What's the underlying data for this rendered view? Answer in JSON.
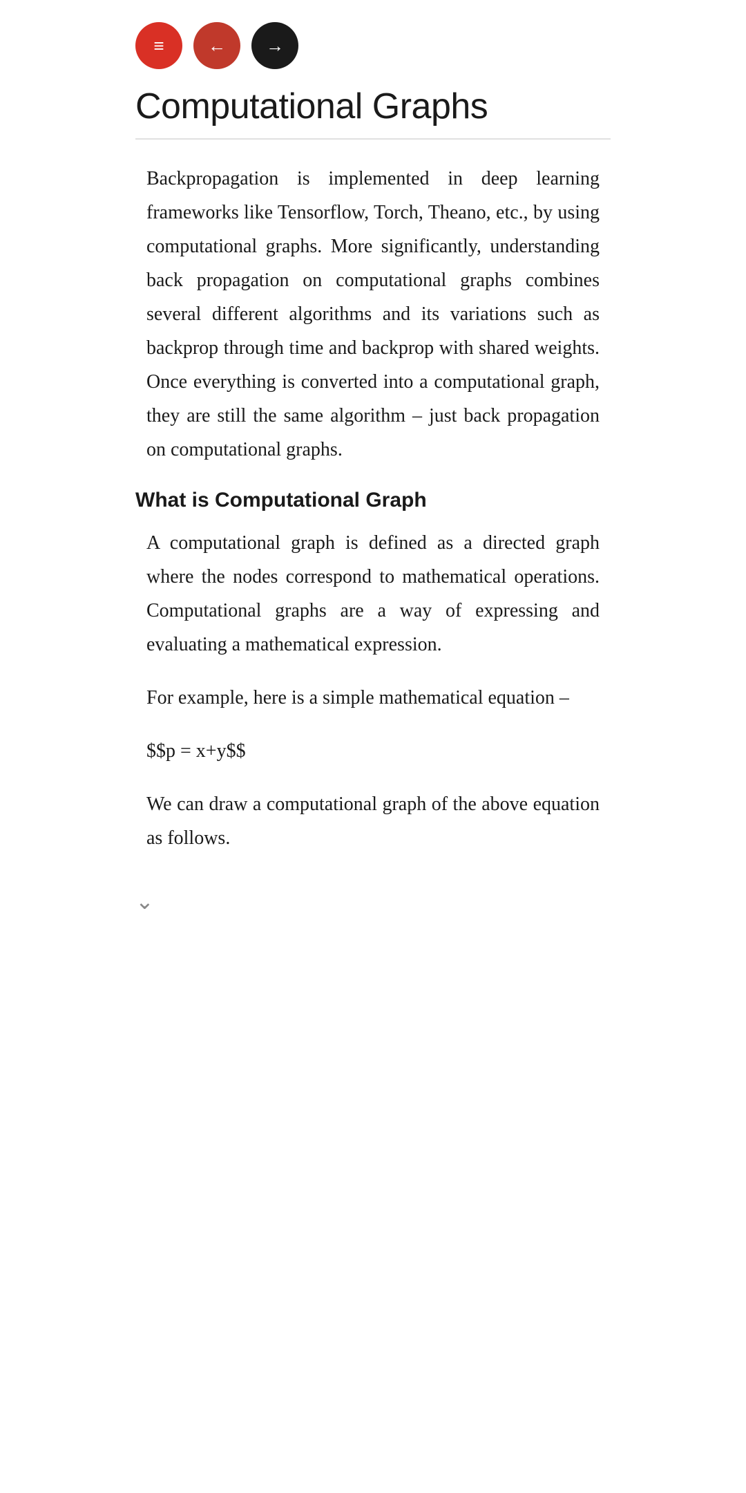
{
  "topBar": {
    "menuIcon": "≡",
    "backIcon": "←",
    "forwardIcon": "→"
  },
  "pageTitle": "Computational Graphs",
  "divider": true,
  "mainParagraph": "Backpropagation is implemented in deep learning frameworks like Tensorflow, Torch, Theano, etc., by using computational graphs. More significantly, understanding back propagation on computational graphs combines several different algorithms and its variations such as backprop through time and backprop with shared weights. Once everything is converted into a computational graph, they are still the same algorithm – just back propagation on computational graphs.",
  "section": {
    "heading": "What is Computational Graph",
    "paragraphs": [
      "A computational graph is defined as a directed graph where the nodes correspond to mathematical operations. Computational graphs are a way of expressing and evaluating a mathematical expression.",
      "For example, here is a simple mathematical equation –",
      "$$p = x+y$$",
      "We can draw a computational graph of the above equation as follows."
    ]
  },
  "chevron": "⌄"
}
